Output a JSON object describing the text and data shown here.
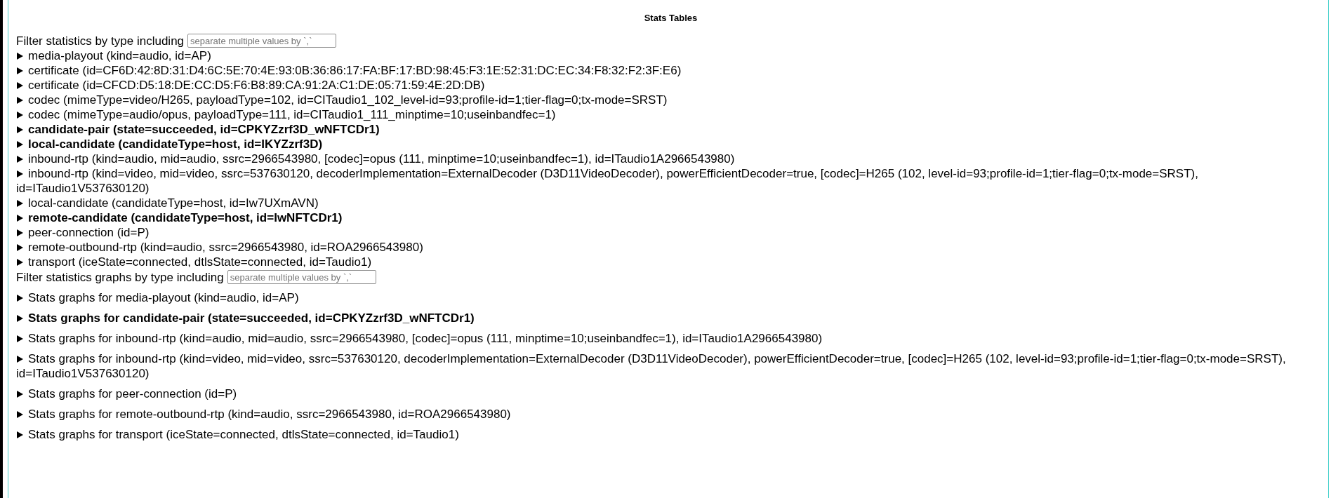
{
  "heading": "Stats Tables",
  "table_filter": {
    "label": "Filter statistics by type including",
    "placeholder": "separate multiple values by `,`"
  },
  "stats_tables": [
    {
      "label": "media-playout (kind=audio, id=AP)",
      "active": false,
      "expanded": false
    },
    {
      "label": "certificate (id=CF6D:42:8D:31:D4:6C:5E:70:4E:93:0B:36:86:17:FA:BF:17:BD:98:45:F3:1E:52:31:DC:EC:34:F8:32:F2:3F:E6)",
      "active": false,
      "expanded": false
    },
    {
      "label": "certificate (id=CFCD:D5:18:DE:CC:D5:F6:B8:89:CA:91:2A:C1:DE:05:71:59:4E:2D:DB)",
      "active": false,
      "expanded": false
    },
    {
      "label": "codec (mimeType=video/H265, payloadType=102, id=CITaudio1_102_level-id=93;profile-id=1;tier-flag=0;tx-mode=SRST)",
      "active": false,
      "expanded": false
    },
    {
      "label": "codec (mimeType=audio/opus, payloadType=111, id=CITaudio1_111_minptime=10;useinbandfec=1)",
      "active": false,
      "expanded": false
    },
    {
      "label": "candidate-pair (state=succeeded, id=CPKYZzrf3D_wNFTCDr1)",
      "active": true,
      "expanded": false
    },
    {
      "label": "local-candidate (candidateType=host, id=IKYZzrf3D)",
      "active": true,
      "expanded": false
    },
    {
      "label": "inbound-rtp (kind=audio, mid=audio, ssrc=2966543980, [codec]=opus (111, minptime=10;useinbandfec=1), id=ITaudio1A2966543980)",
      "active": false,
      "expanded": false
    },
    {
      "label": "inbound-rtp (kind=video, mid=video, ssrc=537630120, decoderImplementation=ExternalDecoder (D3D11VideoDecoder), powerEfficientDecoder=true, [codec]=H265 (102, level-id=93;profile-id=1;tier-flag=0;tx-mode=SRST), id=ITaudio1V537630120)",
      "active": false,
      "expanded": false
    },
    {
      "label": "local-candidate (candidateType=host, id=Iw7UXmAVN)",
      "active": false,
      "expanded": false
    },
    {
      "label": "remote-candidate (candidateType=host, id=IwNFTCDr1)",
      "active": true,
      "expanded": false
    },
    {
      "label": "peer-connection (id=P)",
      "active": false,
      "expanded": false
    },
    {
      "label": "remote-outbound-rtp (kind=audio, ssrc=2966543980, id=ROA2966543980)",
      "active": false,
      "expanded": false
    },
    {
      "label": "transport (iceState=connected, dtlsState=connected, id=Taudio1)",
      "active": false,
      "expanded": false
    }
  ],
  "graph_filter": {
    "label": "Filter statistics graphs by type including",
    "placeholder": "separate multiple values by `,`"
  },
  "stats_graphs": [
    {
      "label": "Stats graphs for media-playout (kind=audio, id=AP)",
      "active": false,
      "expanded": false
    },
    {
      "label": "Stats graphs for candidate-pair (state=succeeded, id=CPKYZzrf3D_wNFTCDr1)",
      "active": true,
      "expanded": false
    },
    {
      "label": "Stats graphs for inbound-rtp (kind=audio, mid=audio, ssrc=2966543980, [codec]=opus (111, minptime=10;useinbandfec=1), id=ITaudio1A2966543980)",
      "active": false,
      "expanded": false
    },
    {
      "label": "Stats graphs for inbound-rtp (kind=video, mid=video, ssrc=537630120, decoderImplementation=ExternalDecoder (D3D11VideoDecoder), powerEfficientDecoder=true, [codec]=H265 (102, level-id=93;profile-id=1;tier-flag=0;tx-mode=SRST), id=ITaudio1V537630120)",
      "active": false,
      "expanded": false
    },
    {
      "label": "Stats graphs for peer-connection (id=P)",
      "active": false,
      "expanded": false
    },
    {
      "label": "Stats graphs for remote-outbound-rtp (kind=audio, ssrc=2966543980, id=ROA2966543980)",
      "active": false,
      "expanded": false
    },
    {
      "label": "Stats graphs for transport (iceState=connected, dtlsState=connected, id=Taudio1)",
      "active": false,
      "expanded": false
    }
  ]
}
